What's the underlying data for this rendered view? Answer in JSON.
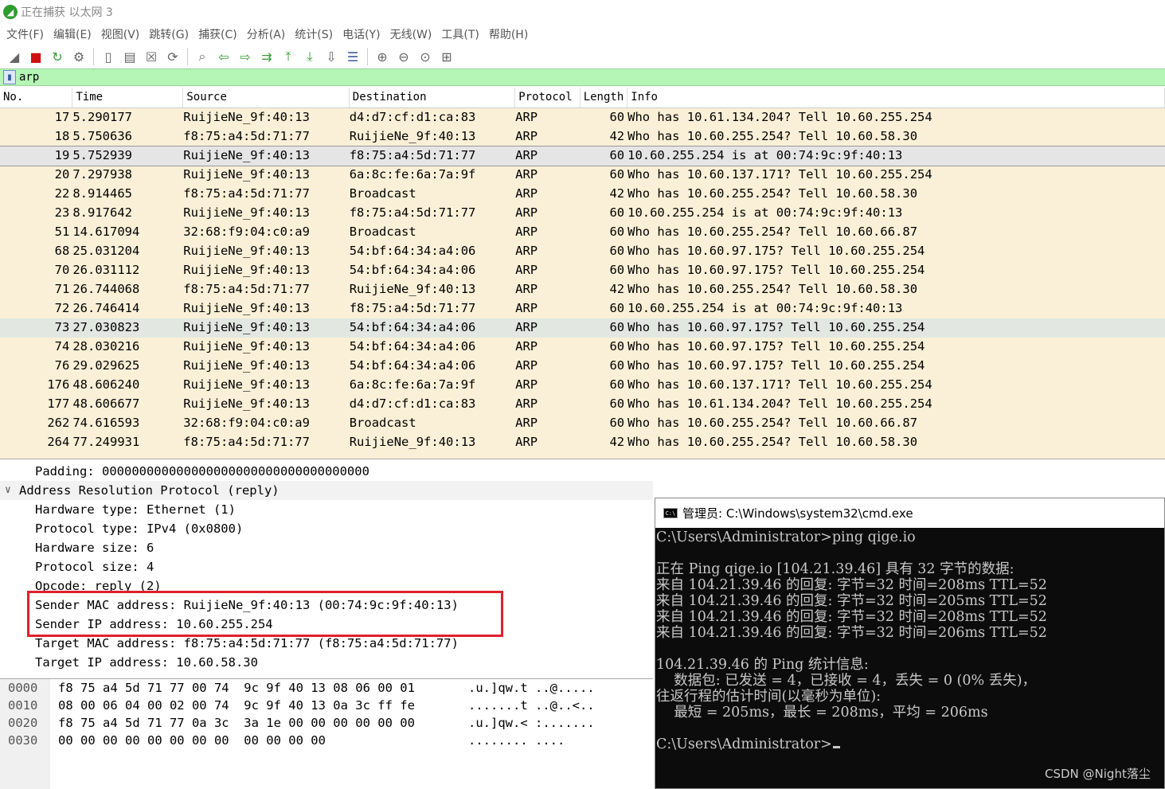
{
  "window": {
    "title": "正在捕获 以太网 3",
    "logo_icon": "wireshark-fin-icon"
  },
  "menu": [
    "文件(F)",
    "编辑(E)",
    "视图(V)",
    "跳转(G)",
    "捕获(C)",
    "分析(A)",
    "统计(S)",
    "电话(Y)",
    "无线(W)",
    "工具(T)",
    "帮助(H)"
  ],
  "toolbar_icons": [
    "start-capture-icon",
    "stop-capture-icon",
    "restart-capture-icon",
    "capture-options-icon",
    "open-file-icon",
    "save-file-icon",
    "close-file-icon",
    "reload-icon",
    "find-packet-icon",
    "go-back-icon",
    "go-forward-icon",
    "go-to-packet-icon",
    "go-first-icon",
    "go-last-icon",
    "autoscroll-icon",
    "colorize-icon",
    "zoom-in-icon",
    "zoom-out-icon",
    "zoom-normal-icon",
    "resize-columns-icon"
  ],
  "filter": {
    "value": "arp",
    "background_color": "#b5f5b5"
  },
  "packet_list": {
    "columns": [
      "No.",
      "Time",
      "Source",
      "Destination",
      "Protocol",
      "Length",
      "Info"
    ],
    "rows": [
      {
        "no": "17",
        "time": "5.290177",
        "source": "RuijieNe_9f:40:13",
        "destination": "d4:d7:cf:d1:ca:83",
        "protocol": "ARP",
        "length": "60",
        "info": "Who has 10.61.134.204? Tell 10.60.255.254"
      },
      {
        "no": "18",
        "time": "5.750636",
        "source": "f8:75:a4:5d:71:77",
        "destination": "RuijieNe_9f:40:13",
        "protocol": "ARP",
        "length": "42",
        "info": "Who has 10.60.255.254? Tell 10.60.58.30"
      },
      {
        "no": "19",
        "time": "5.752939",
        "source": "RuijieNe_9f:40:13",
        "destination": "f8:75:a4:5d:71:77",
        "protocol": "ARP",
        "length": "60",
        "info": "10.60.255.254 is at 00:74:9c:9f:40:13",
        "selected": true
      },
      {
        "no": "20",
        "time": "7.297938",
        "source": "RuijieNe_9f:40:13",
        "destination": "6a:8c:fe:6a:7a:9f",
        "protocol": "ARP",
        "length": "60",
        "info": "Who has 10.60.137.171? Tell 10.60.255.254"
      },
      {
        "no": "22",
        "time": "8.914465",
        "source": "f8:75:a4:5d:71:77",
        "destination": "Broadcast",
        "protocol": "ARP",
        "length": "42",
        "info": "Who has 10.60.255.254? Tell 10.60.58.30"
      },
      {
        "no": "23",
        "time": "8.917642",
        "source": "RuijieNe_9f:40:13",
        "destination": "f8:75:a4:5d:71:77",
        "protocol": "ARP",
        "length": "60",
        "info": "10.60.255.254 is at 00:74:9c:9f:40:13"
      },
      {
        "no": "51",
        "time": "14.617094",
        "source": "32:68:f9:04:c0:a9",
        "destination": "Broadcast",
        "protocol": "ARP",
        "length": "60",
        "info": "Who has 10.60.255.254? Tell 10.60.66.87"
      },
      {
        "no": "68",
        "time": "25.031204",
        "source": "RuijieNe_9f:40:13",
        "destination": "54:bf:64:34:a4:06",
        "protocol": "ARP",
        "length": "60",
        "info": "Who has 10.60.97.175? Tell 10.60.255.254"
      },
      {
        "no": "70",
        "time": "26.031112",
        "source": "RuijieNe_9f:40:13",
        "destination": "54:bf:64:34:a4:06",
        "protocol": "ARP",
        "length": "60",
        "info": "Who has 10.60.97.175? Tell 10.60.255.254"
      },
      {
        "no": "71",
        "time": "26.744068",
        "source": "f8:75:a4:5d:71:77",
        "destination": "RuijieNe_9f:40:13",
        "protocol": "ARP",
        "length": "42",
        "info": "Who has 10.60.255.254? Tell 10.60.58.30"
      },
      {
        "no": "72",
        "time": "26.746414",
        "source": "RuijieNe_9f:40:13",
        "destination": "f8:75:a4:5d:71:77",
        "protocol": "ARP",
        "length": "60",
        "info": "10.60.255.254 is at 00:74:9c:9f:40:13"
      },
      {
        "no": "73",
        "time": "27.030823",
        "source": "RuijieNe_9f:40:13",
        "destination": "54:bf:64:34:a4:06",
        "protocol": "ARP",
        "length": "60",
        "info": "Who has 10.60.97.175? Tell 10.60.255.254",
        "highlight": true
      },
      {
        "no": "74",
        "time": "28.030216",
        "source": "RuijieNe_9f:40:13",
        "destination": "54:bf:64:34:a4:06",
        "protocol": "ARP",
        "length": "60",
        "info": "Who has 10.60.97.175? Tell 10.60.255.254"
      },
      {
        "no": "76",
        "time": "29.029625",
        "source": "RuijieNe_9f:40:13",
        "destination": "54:bf:64:34:a4:06",
        "protocol": "ARP",
        "length": "60",
        "info": "Who has 10.60.97.175? Tell 10.60.255.254"
      },
      {
        "no": "176",
        "time": "48.606240",
        "source": "RuijieNe_9f:40:13",
        "destination": "6a:8c:fe:6a:7a:9f",
        "protocol": "ARP",
        "length": "60",
        "info": "Who has 10.60.137.171? Tell 10.60.255.254"
      },
      {
        "no": "177",
        "time": "48.606677",
        "source": "RuijieNe_9f:40:13",
        "destination": "d4:d7:cf:d1:ca:83",
        "protocol": "ARP",
        "length": "60",
        "info": "Who has 10.61.134.204? Tell 10.60.255.254"
      },
      {
        "no": "262",
        "time": "74.616593",
        "source": "32:68:f9:04:c0:a9",
        "destination": "Broadcast",
        "protocol": "ARP",
        "length": "60",
        "info": "Who has 10.60.255.254? Tell 10.60.66.87"
      },
      {
        "no": "264",
        "time": "77.249931",
        "source": "f8:75:a4:5d:71:77",
        "destination": "RuijieNe_9f:40:13",
        "protocol": "ARP",
        "length": "42",
        "info": "Who has 10.60.255.254? Tell 10.60.58.30"
      }
    ]
  },
  "details": {
    "padding": "Padding: 000000000000000000000000000000000000",
    "section": "Address Resolution Protocol (reply)",
    "fields": [
      "Hardware type: Ethernet (1)",
      "Protocol type: IPv4 (0x0800)",
      "Hardware size: 6",
      "Protocol size: 4",
      "Opcode: reply (2)",
      "Sender MAC address: RuijieNe_9f:40:13 (00:74:9c:9f:40:13)",
      "Sender IP address: 10.60.255.254",
      "Target MAC address: f8:75:a4:5d:71:77 (f8:75:a4:5d:71:77)",
      "Target IP address: 10.60.58.30"
    ],
    "highlight_color": "#e0202c"
  },
  "hex": [
    {
      "offset": "0000",
      "bytes": "f8 75 a4 5d 71 77 00 74  9c 9f 40 13 08 06 00 01",
      "ascii": ".u.]qw.t ..@....."
    },
    {
      "offset": "0010",
      "bytes": "08 00 06 04 00 02 00 74  9c 9f 40 13 0a 3c ff fe",
      "ascii": ".......t ..@..<.."
    },
    {
      "offset": "0020",
      "bytes": "f8 75 a4 5d 71 77 0a 3c  3a 1e 00 00 00 00 00 00",
      "ascii": ".u.]qw.< :......."
    },
    {
      "offset": "0030",
      "bytes": "00 00 00 00 00 00 00 00  00 00 00 00",
      "ascii": "........ ...."
    }
  ],
  "cmd": {
    "title": "管理员: C:\\Windows\\system32\\cmd.exe",
    "icon_text": "C:\\",
    "lines": [
      "C:\\Users\\Administrator>ping qige.io",
      "",
      "正在 Ping qige.io [104.21.39.46] 具有 32 字节的数据:",
      "来自 104.21.39.46 的回复: 字节=32 时间=208ms TTL=52",
      "来自 104.21.39.46 的回复: 字节=32 时间=205ms TTL=52",
      "来自 104.21.39.46 的回复: 字节=32 时间=208ms TTL=52",
      "来自 104.21.39.46 的回复: 字节=32 时间=206ms TTL=52",
      "",
      "104.21.39.46 的 Ping 统计信息:",
      "    数据包: 已发送 = 4，已接收 = 4，丢失 = 0 (0% 丢失)，",
      "往返行程的估计时间(以毫秒为单位):",
      "    最短 = 205ms，最长 = 208ms，平均 = 206ms",
      ""
    ],
    "prompt": "C:\\Users\\Administrator>"
  },
  "watermark": "CSDN @Night落尘"
}
